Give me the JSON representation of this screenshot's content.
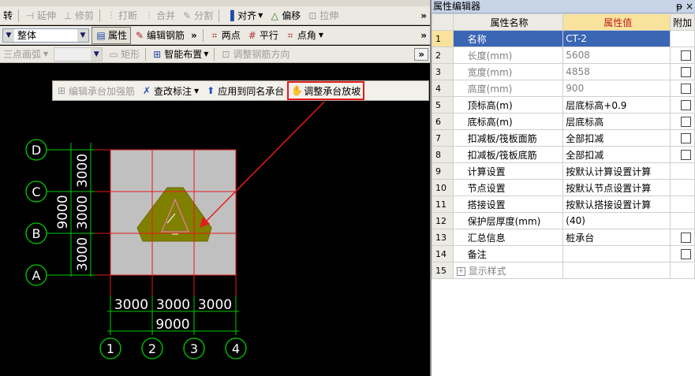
{
  "toolbar": {
    "row2": {
      "t0": "转",
      "extend": "延伸",
      "trim": "修剪",
      "break": "打断",
      "merge": "合并",
      "split": "分割",
      "align": "对齐",
      "offset": "偏移",
      "stretch": "拉伸",
      "more": "»"
    },
    "row3": {
      "scope_value": "整体",
      "props": "属性",
      "edit_rebar": "编辑钢筋",
      "more": "»",
      "two_points": "两点",
      "parallel": "平行",
      "point_angle": "点角",
      "more2": "»"
    },
    "row4": {
      "arc": "三点画弧",
      "rect": "矩形",
      "smart_layout": "智能布置",
      "rebar_dir": "调整钢筋方向",
      "more": "»"
    },
    "floating": {
      "edit_cap_rebar": "编辑承台加强筋",
      "check_annot": "查改标注",
      "apply_same": "应用到同名承台",
      "adjust_slope": "调整承台放坡"
    }
  },
  "canvas": {
    "axis_rows": [
      "D",
      "C",
      "B",
      "A"
    ],
    "axis_cols": [
      "1",
      "2",
      "3",
      "4"
    ],
    "left_dims": [
      "3000",
      "3000",
      "3000"
    ],
    "left_total": "9000",
    "bottom_dims": [
      "3000",
      "3000",
      "3000"
    ],
    "bottom_total": "9000",
    "colors": {
      "cap": "#808000",
      "slab": "#c0c0c0",
      "axis": "#e11b1b",
      "dim": "#00cc00",
      "arrow": "#e41b1b"
    }
  },
  "panel": {
    "title": "属性编辑器",
    "controls": "ᵽ ×",
    "headers": {
      "name": "属性名称",
      "value": "属性值",
      "add": "附加"
    },
    "rows": [
      {
        "idx": "1",
        "name": "名称",
        "value": "CT-2",
        "gray": false,
        "check": false
      },
      {
        "idx": "2",
        "name": "长度(mm)",
        "value": "5608",
        "gray": true,
        "check": true
      },
      {
        "idx": "3",
        "name": "宽度(mm)",
        "value": "4858",
        "gray": true,
        "check": true
      },
      {
        "idx": "4",
        "name": "高度(mm)",
        "value": "900",
        "gray": true,
        "check": true
      },
      {
        "idx": "5",
        "name": "顶标高(m)",
        "value": "层底标高+0.9",
        "gray": false,
        "check": true
      },
      {
        "idx": "6",
        "name": "底标高(m)",
        "value": "层底标高",
        "gray": false,
        "check": true
      },
      {
        "idx": "7",
        "name": "扣减板/筏板面筋",
        "value": "全部扣减",
        "gray": false,
        "check": true
      },
      {
        "idx": "8",
        "name": "扣减板/筏板底筋",
        "value": "全部扣减",
        "gray": false,
        "check": true
      },
      {
        "idx": "9",
        "name": "计算设置",
        "value": "按默认计算设置计算",
        "gray": false,
        "check": false
      },
      {
        "idx": "10",
        "name": "节点设置",
        "value": "按默认节点设置计算",
        "gray": false,
        "check": false
      },
      {
        "idx": "11",
        "name": "搭接设置",
        "value": "按默认搭接设置计算",
        "gray": false,
        "check": false
      },
      {
        "idx": "12",
        "name": "保护层厚度(mm)",
        "value": "(40)",
        "gray": false,
        "check": false
      },
      {
        "idx": "13",
        "name": "汇总信息",
        "value": "桩承台",
        "gray": false,
        "check": true
      },
      {
        "idx": "14",
        "name": "备注",
        "value": "",
        "gray": false,
        "check": true
      },
      {
        "idx": "15",
        "name": "显示样式",
        "value": "",
        "gray": true,
        "check": false
      }
    ]
  }
}
